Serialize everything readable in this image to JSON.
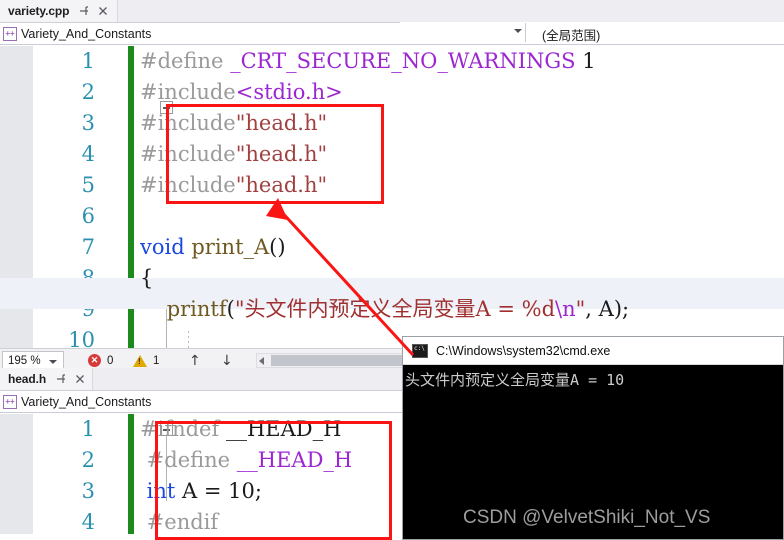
{
  "editor_top": {
    "tab": {
      "title": "variety.cpp",
      "pin_icon": "pin-icon",
      "close_icon": "close-icon"
    },
    "breadcrumb": {
      "icon": "cpp-project-icon",
      "icon_glyph": "++",
      "text": "Variety_And_Constants"
    },
    "scope": {
      "caret_icon": "chevron-down-icon",
      "value": "(全局范围)"
    },
    "line_numbers": [
      "1",
      "2",
      "3",
      "4",
      "5",
      "6",
      "7",
      "8",
      "9",
      "10"
    ],
    "lines": [
      {
        "n": 1,
        "tokens": [
          {
            "t": "#define ",
            "c": "c-pre"
          },
          {
            "t": "_CRT_SECURE_NO_WARNINGS",
            "c": "c-macro"
          },
          {
            "t": " 1",
            "c": "c-num"
          }
        ]
      },
      {
        "n": 2,
        "tokens": [
          {
            "t": "#include",
            "c": "c-pre"
          },
          {
            "t": "<stdio.h>",
            "c": "c-angle"
          }
        ]
      },
      {
        "n": 3,
        "tokens": [
          {
            "t": "#include",
            "c": "c-pre"
          },
          {
            "t": "\"head.h\"",
            "c": "c-incl"
          }
        ]
      },
      {
        "n": 4,
        "tokens": [
          {
            "t": "#include",
            "c": "c-pre"
          },
          {
            "t": "\"head.h\"",
            "c": "c-incl"
          }
        ]
      },
      {
        "n": 5,
        "tokens": [
          {
            "t": "#include",
            "c": "c-pre"
          },
          {
            "t": "\"head.h\"",
            "c": "c-incl"
          }
        ]
      },
      {
        "n": 6,
        "tokens": []
      },
      {
        "n": 7,
        "tokens": [
          {
            "t": "void ",
            "c": "c-kw"
          },
          {
            "t": "print_A",
            "c": "c-fn"
          },
          {
            "t": "()",
            "c": "c-plain"
          }
        ]
      },
      {
        "n": 8,
        "tokens": [
          {
            "t": "{",
            "c": "c-plain"
          }
        ]
      },
      {
        "n": 9,
        "tokens": [
          {
            "t": "    printf",
            "c": "c-fn"
          },
          {
            "t": "(",
            "c": "c-plain"
          },
          {
            "t": "\"头文件内预定义全局变量A = %d",
            "c": "c-str"
          },
          {
            "t": "\\n",
            "c": "c-esc"
          },
          {
            "t": "\"",
            "c": "c-str"
          },
          {
            "t": ", A);",
            "c": "c-plain"
          }
        ]
      },
      {
        "n": 10,
        "tokens": []
      }
    ]
  },
  "status_bar": {
    "zoom_level": "195 %",
    "zoom_caret_icon": "chevron-down-icon",
    "error_icon": "error-icon",
    "error_count": "0",
    "warning_icon": "warning-icon",
    "warning_count": "1",
    "prev_icon": "arrow-up-icon",
    "next_icon": "arrow-down-icon",
    "scroll_left_icon": "scroll-left-arrow-icon"
  },
  "editor_bottom": {
    "tab": {
      "title": "head.h",
      "pin_icon": "pin-icon",
      "close_icon": "close-icon"
    },
    "breadcrumb": {
      "icon": "cpp-project-icon",
      "icon_glyph": "++",
      "text": "Variety_And_Constants"
    },
    "line_numbers": [
      "1",
      "2",
      "3",
      "4"
    ],
    "lines": [
      {
        "n": 1,
        "tokens": [
          {
            "t": "#ifndef ",
            "c": "c-pre"
          },
          {
            "t": "__HEAD_H",
            "c": "c-id"
          }
        ]
      },
      {
        "n": 2,
        "tokens": [
          {
            "t": " #define ",
            "c": "c-pre"
          },
          {
            "t": "__HEAD_H",
            "c": "c-macro"
          }
        ]
      },
      {
        "n": 3,
        "tokens": [
          {
            "t": " int",
            "c": "c-kw"
          },
          {
            "t": " A = 10;",
            "c": "c-plain"
          }
        ]
      },
      {
        "n": 4,
        "tokens": [
          {
            "t": " #endif",
            "c": "c-pre"
          }
        ]
      }
    ]
  },
  "console": {
    "title": "C:\\Windows\\system32\\cmd.exe",
    "icon": "cmd-console-icon",
    "output": "头文件内预定义全局变量A = 10"
  },
  "watermark": {
    "text": "CSDN @VelvetShiki_Not_VS"
  },
  "annotations": {
    "color": "#fb1414",
    "box_includes": "highlight-duplicate-includes",
    "box_header": "highlight-header-guard",
    "arrow": "arrow-from-header-to-includes"
  }
}
